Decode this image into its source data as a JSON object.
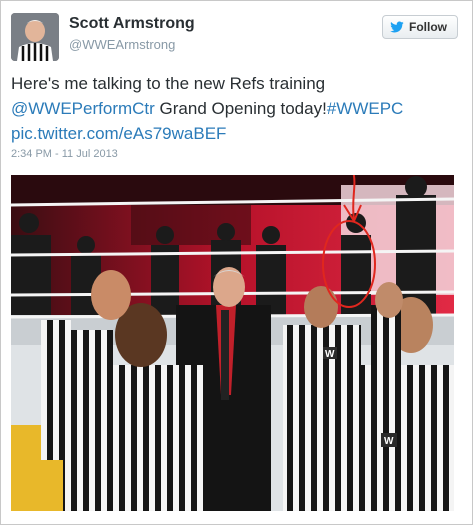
{
  "tweet": {
    "author_name": "Scott Armstrong",
    "author_handle": "@WWEArmstrong",
    "follow_label": "Follow",
    "text_plain_1": "Here's me talking to the new Refs training",
    "mention": "@WWEPerformCtr",
    "text_plain_2": " Grand Opening today!",
    "hashtag": "#WWEPC",
    "pic_link": "pic.twitter.com/eAs79waBEF",
    "timestamp": "2:34 PM - 11 Jul 2013"
  },
  "photo": {
    "description_icon": "photo-wrestling-ring-referees",
    "wwe_badge_text": "W"
  },
  "colors": {
    "link": "#2b7bb9",
    "annotation": "#e0271e",
    "follow_bird": "#1da1f2"
  }
}
